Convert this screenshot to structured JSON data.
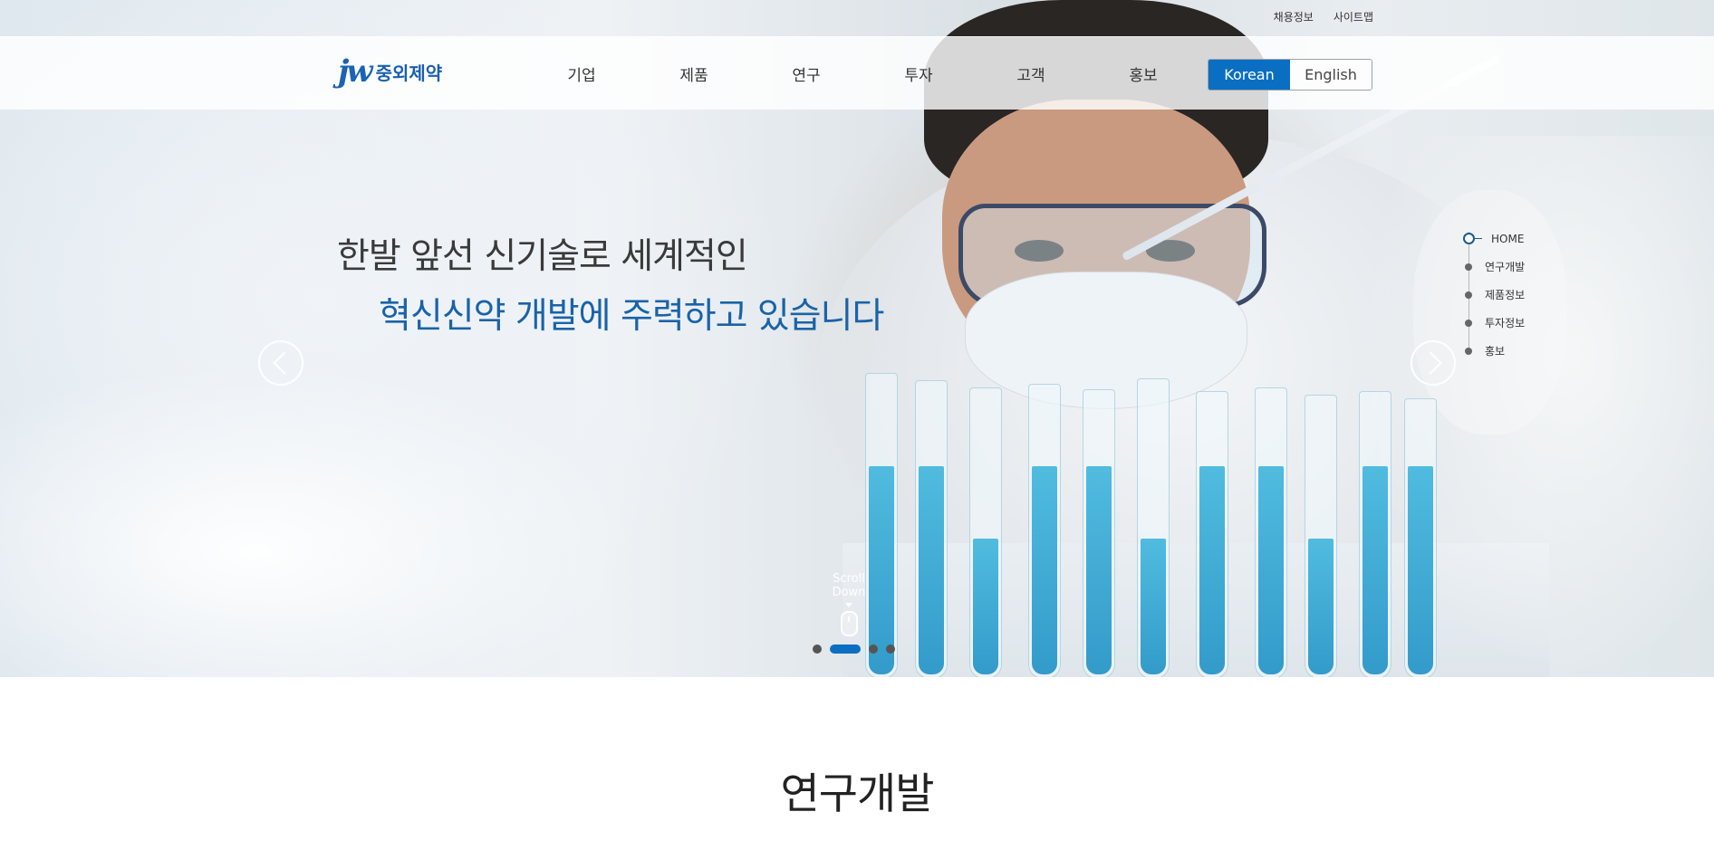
{
  "utility_links": [
    "채용정보",
    "사이트맵"
  ],
  "logo": {
    "mark": "jw",
    "name": "중외제약"
  },
  "nav": [
    "기업",
    "제품",
    "연구",
    "투자",
    "고객",
    "홍보"
  ],
  "language": {
    "korean": "Korean",
    "english": "English",
    "active": "Korean"
  },
  "hero": {
    "line1": "한발 앞선 신기술로 세계적인",
    "line2": "혁신신약 개발에 주력하고 있습니다",
    "scroll_label": "Scroll Down",
    "active_slide": 2,
    "slide_count": 4
  },
  "side_nav": [
    {
      "label": "HOME",
      "active": true
    },
    {
      "label": "연구개발",
      "active": false
    },
    {
      "label": "제품정보",
      "active": false
    },
    {
      "label": "투자정보",
      "active": false
    },
    {
      "label": "홍보",
      "active": false
    }
  ],
  "section": {
    "title": "연구개발"
  },
  "colors": {
    "brand_blue": "#0a6fc2",
    "headline_blue": "#1a63a8",
    "logo_blue": "#1a63b5"
  }
}
